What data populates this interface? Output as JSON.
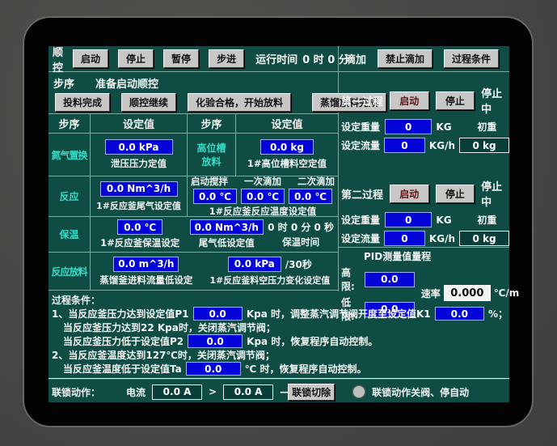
{
  "colors": {
    "screen_bg": "#0e4c44",
    "value_box_blue": "#0404d8",
    "step_label_cyan": "#38dcc6",
    "button_gray": "#c7c7c7",
    "grid_line": "#7fa89f"
  },
  "seq": {
    "label": "顺控",
    "btn_start": "启动",
    "btn_stop": "停止",
    "btn_pause": "暂停",
    "btn_step": "步进",
    "runtime_label": "运行时间",
    "runtime_value": "0 时 0 分"
  },
  "drip": {
    "label": "滴加",
    "btn_forbid": "禁止滴加",
    "btn_cond": "过程条件"
  },
  "step": {
    "label": "步序",
    "status": "准备启动顺控"
  },
  "actions": [
    "投料完成",
    "顺控继续",
    "化验合格，开始放料",
    "蒸馏放料完成"
  ],
  "table": {
    "h1": "步序",
    "h2": "设定值",
    "h3": "步序",
    "h4": "设定值",
    "r1": {
      "step": "氮气置换",
      "v1": "0.0 kPa",
      "d1": "泄压压力定值",
      "step2a": "高位槽",
      "step2b": "放料",
      "v2": "0.0 kg",
      "d2": "1#高位槽料空定值"
    },
    "r2": {
      "step": "反应",
      "v1": "0.0 Nm^3/h",
      "d1": "1#反应釜尾气设定值",
      "sh1": "启动搅拌",
      "sh2": "一次滴加",
      "sh3": "二次滴加",
      "t1": "0.0 ℃",
      "t2": "0.0 ℃",
      "t3": "0.0 ℃",
      "d2": "1#反应釜反应温度设定值"
    },
    "r3": {
      "step": "保温",
      "v1": "0.0 ℃",
      "d1": "1#反应釜保温设定",
      "v2": "0.0 Nm^3/h",
      "d2": "尾气低设定值",
      "time": "0 时 0 分 0 秒",
      "time_label": "保温时间"
    },
    "r4": {
      "step": "反应放料",
      "v1": "0.0 m^3/h",
      "d1": "蒸馏釜进料流量低设定",
      "v2": "0.0 kPa",
      "v2suffix": "/30秒",
      "d2": "1#反应釜料空压力变化设定值"
    }
  },
  "process1": {
    "title": "第一过程",
    "btn_start": "启动",
    "btn_stop": "停止",
    "status": "停止中",
    "w_label": "设定重量",
    "w_value": "0",
    "w_unit": "KG",
    "init_label": "初重",
    "f_label": "设定流量",
    "f_value": "0",
    "f_unit": "KG/h",
    "init_value": "0 kg"
  },
  "process2": {
    "title": "第二过程",
    "btn_start": "启动",
    "btn_stop": "停止",
    "status": "停止中",
    "w_label": "设定重量",
    "w_value": "0",
    "w_unit": "KG",
    "init_label": "初重",
    "f_label": "设定流量",
    "f_value": "0",
    "f_unit": "KG/h",
    "init_value": "0 kg"
  },
  "pid": {
    "title": "PID测量值量程",
    "high_label": "高限:",
    "high": "0.0",
    "low_label": "低限:",
    "low": "0.0",
    "rate_label": "速率",
    "rate": "0.000",
    "rate_unit": "℃/m"
  },
  "cond": {
    "title": "过程条件：",
    "l1a": "1、当反应釜压力达到设定值P1",
    "l1v": "0.0",
    "l1b": "Kpa 时，调整蒸汽调节阀开度至设定值K1",
    "l1v2": "0.0",
    "l1c": "%；",
    "l2": "当反应釜压力达到22 Kpa时，关闭蒸汽调节阀；",
    "l3a": "当反应釜压力低于设定值P2",
    "l3v": "0.0",
    "l3b": "Kpa 时，恢复程序自动控制。",
    "l4": "2、当反应釜温度达到127℃时，关闭蒸汽调节阀；",
    "l5a": "当反应釜温度低于设定值Ta",
    "l5v": "0.0",
    "l5b": "℃ 时，恢复程序自动控制。"
  },
  "interlock": {
    "label": "联锁动作：",
    "cur_label": "电流",
    "v1": "0.0 A",
    "op": ">",
    "v2": "0.0 A",
    "dash": "—",
    "btn_cut": "联锁切除",
    "desc": "联锁动作关阀、停自动"
  }
}
